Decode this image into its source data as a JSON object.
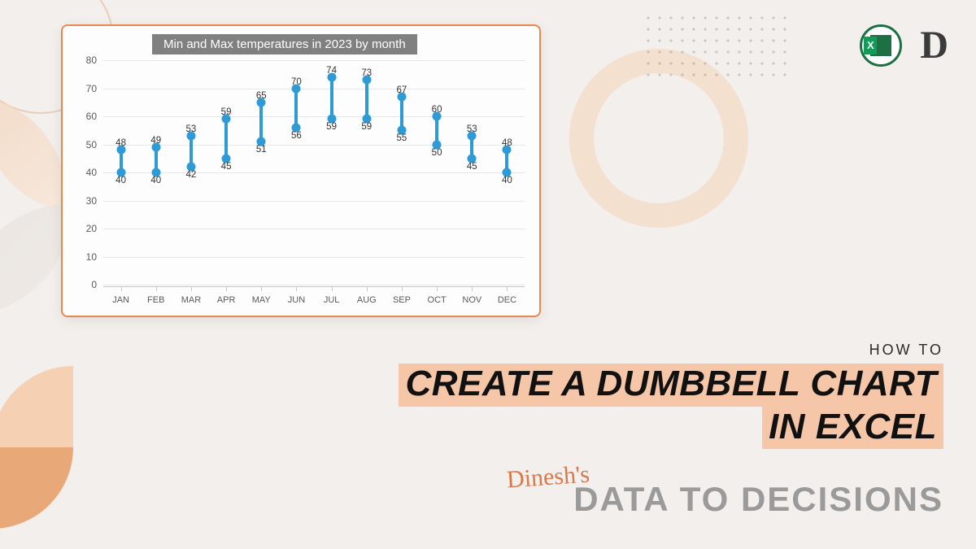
{
  "chart_data": {
    "type": "dumbbell",
    "title": "Min and Max temperatures in 2023 by month",
    "categories": [
      "JAN",
      "FEB",
      "MAR",
      "APR",
      "MAY",
      "JUN",
      "JUL",
      "AUG",
      "SEP",
      "OCT",
      "NOV",
      "DEC"
    ],
    "series": [
      {
        "name": "Min",
        "values": [
          40,
          40,
          42,
          45,
          51,
          56,
          59,
          59,
          55,
          50,
          45,
          40
        ]
      },
      {
        "name": "Max",
        "values": [
          48,
          49,
          53,
          59,
          65,
          70,
          74,
          73,
          67,
          60,
          53,
          48
        ]
      }
    ],
    "ylabel": "",
    "xlabel": "",
    "ylim": [
      0,
      80
    ],
    "ytick_step": 10,
    "yticks": [
      0,
      10,
      20,
      30,
      40,
      50,
      60,
      70,
      80
    ],
    "color": "#2e9bd6"
  },
  "headline": {
    "overline": "HOW TO",
    "line1": "CREATE A DUMBBELL CHART",
    "line2": "IN EXCEL"
  },
  "signature": "Dinesh's",
  "brand": "DATA TO DECISIONS",
  "badges": {
    "excel_alt": "excel-icon",
    "logo_letter": "D"
  }
}
